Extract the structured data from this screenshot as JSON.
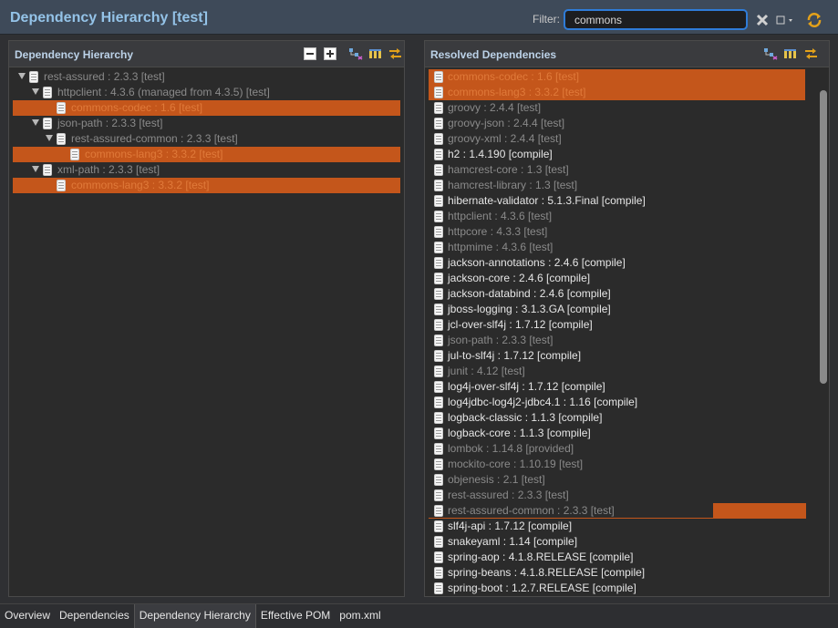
{
  "header": {
    "title": "Dependency Hierarchy [test]",
    "filter_label": "Filter:",
    "filter_value": "commons",
    "filter_icons": [
      "clear-filter-icon",
      "filter-options-icon",
      "refresh-icon"
    ]
  },
  "left_panel": {
    "title": "Dependency Hierarchy",
    "toolbar_icons": [
      "collapse-all-icon",
      "expand-all-icon",
      "show-group-id-icon",
      "select-columns-icon",
      "link-with-selection-icon"
    ],
    "rows": [
      {
        "level": 0,
        "twisty": true,
        "text": "rest-assured : 2.3.3 [test]",
        "style": "dim",
        "hl": false
      },
      {
        "level": 1,
        "twisty": true,
        "text": "httpclient : 4.3.6 (managed from 4.3.5) [test]",
        "style": "dim",
        "hl": false
      },
      {
        "level": 2,
        "twisty": false,
        "text": "commons-codec : 1.6 [test]",
        "style": "hl",
        "hl": true
      },
      {
        "level": 1,
        "twisty": true,
        "text": "json-path : 2.3.3 [test]",
        "style": "dim",
        "hl": false
      },
      {
        "level": 2,
        "twisty": true,
        "text": "rest-assured-common : 2.3.3 [test]",
        "style": "dim",
        "hl": false
      },
      {
        "level": 3,
        "twisty": false,
        "text": "commons-lang3 : 3.3.2 [test]",
        "style": "hl",
        "hl": true
      },
      {
        "level": 1,
        "twisty": true,
        "text": "xml-path : 2.3.3 [test]",
        "style": "dim",
        "hl": false
      },
      {
        "level": 2,
        "twisty": false,
        "text": "commons-lang3 : 3.3.2 [test]",
        "style": "hl",
        "hl": true
      }
    ]
  },
  "right_panel": {
    "title": "Resolved Dependencies",
    "toolbar_icons": [
      "show-group-id-icon",
      "select-columns-icon",
      "link-with-selection-icon"
    ],
    "rows": [
      {
        "text": "commons-codec : 1.6 [test]",
        "style": "hl",
        "hl": true
      },
      {
        "text": "commons-lang3 : 3.3.2 [test]",
        "style": "hl",
        "hl": true
      },
      {
        "text": "groovy : 2.4.4 [test]",
        "style": "dim",
        "hl": false
      },
      {
        "text": "groovy-json : 2.4.4 [test]",
        "style": "dim",
        "hl": false
      },
      {
        "text": "groovy-xml : 2.4.4 [test]",
        "style": "dim",
        "hl": false
      },
      {
        "text": "h2 : 1.4.190 [compile]",
        "style": "normal",
        "hl": false
      },
      {
        "text": "hamcrest-core : 1.3 [test]",
        "style": "dim",
        "hl": false
      },
      {
        "text": "hamcrest-library : 1.3 [test]",
        "style": "dim",
        "hl": false
      },
      {
        "text": "hibernate-validator : 5.1.3.Final [compile]",
        "style": "normal",
        "hl": false
      },
      {
        "text": "httpclient : 4.3.6 [test]",
        "style": "dim",
        "hl": false
      },
      {
        "text": "httpcore : 4.3.3 [test]",
        "style": "dim",
        "hl": false
      },
      {
        "text": "httpmime : 4.3.6 [test]",
        "style": "dim",
        "hl": false
      },
      {
        "text": "jackson-annotations : 2.4.6 [compile]",
        "style": "normal",
        "hl": false
      },
      {
        "text": "jackson-core : 2.4.6 [compile]",
        "style": "normal",
        "hl": false
      },
      {
        "text": "jackson-databind : 2.4.6 [compile]",
        "style": "normal",
        "hl": false
      },
      {
        "text": "jboss-logging : 3.1.3.GA [compile]",
        "style": "normal",
        "hl": false
      },
      {
        "text": "jcl-over-slf4j : 1.7.12 [compile]",
        "style": "normal",
        "hl": false
      },
      {
        "text": "json-path : 2.3.3 [test]",
        "style": "dim",
        "hl": false
      },
      {
        "text": "jul-to-slf4j : 1.7.12 [compile]",
        "style": "normal",
        "hl": false
      },
      {
        "text": "junit : 4.12 [test]",
        "style": "dim",
        "hl": false
      },
      {
        "text": "log4j-over-slf4j : 1.7.12 [compile]",
        "style": "normal",
        "hl": false
      },
      {
        "text": "log4jdbc-log4j2-jdbc4.1 : 1.16 [compile]",
        "style": "normal",
        "hl": false
      },
      {
        "text": "logback-classic : 1.1.3 [compile]",
        "style": "normal",
        "hl": false
      },
      {
        "text": "logback-core : 1.1.3 [compile]",
        "style": "normal",
        "hl": false
      },
      {
        "text": "lombok : 1.14.8 [provided]",
        "style": "dim",
        "hl": false
      },
      {
        "text": "mockito-core : 1.10.19 [test]",
        "style": "dim",
        "hl": false
      },
      {
        "text": "objenesis : 2.1 [test]",
        "style": "dim",
        "hl": false
      },
      {
        "text": "rest-assured : 2.3.3 [test]",
        "style": "dim",
        "hl": false
      },
      {
        "text": "rest-assured-common : 2.3.3 [test]",
        "style": "dim",
        "hl": false
      },
      {
        "text": "slf4j-api : 1.7.12 [compile]",
        "style": "normal",
        "hl": false
      },
      {
        "text": "snakeyaml : 1.14 [compile]",
        "style": "normal",
        "hl": false
      },
      {
        "text": "spring-aop : 4.1.8.RELEASE [compile]",
        "style": "normal",
        "hl": false
      },
      {
        "text": "spring-beans : 4.1.8.RELEASE [compile]",
        "style": "normal",
        "hl": false
      },
      {
        "text": "spring-boot : 1.2.7.RELEASE [compile]",
        "style": "normal",
        "hl": false
      }
    ]
  },
  "bottom_tabs": [
    {
      "label": "Overview",
      "active": false
    },
    {
      "label": "Dependencies",
      "active": false
    },
    {
      "label": "Dependency Hierarchy",
      "active": true
    },
    {
      "label": "Effective POM",
      "active": false
    },
    {
      "label": "pom.xml",
      "active": false
    }
  ],
  "colors": {
    "highlight": "#c4561b",
    "highlight_text": "#e07a3a",
    "title": "#94c3e8",
    "focus_ring": "#2f7cd8"
  }
}
